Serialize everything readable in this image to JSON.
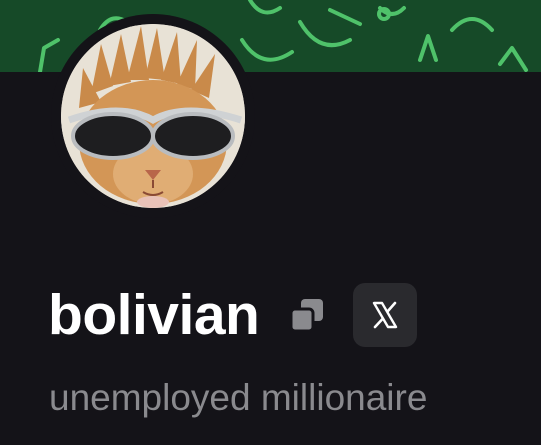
{
  "profile": {
    "display_name": "bolivian",
    "bio": "unemployed millionaire",
    "avatar_description": "cat with sunglasses"
  },
  "actions": {
    "copy_icon": "copy-icon",
    "social_icon": "x-logo-icon"
  },
  "colors": {
    "background": "#141318",
    "banner": "#164a28",
    "banner_doodle": "#4fc26a",
    "name": "#ffffff",
    "bio": "#8a8a8e",
    "social_button_bg": "#2a2a2e"
  }
}
